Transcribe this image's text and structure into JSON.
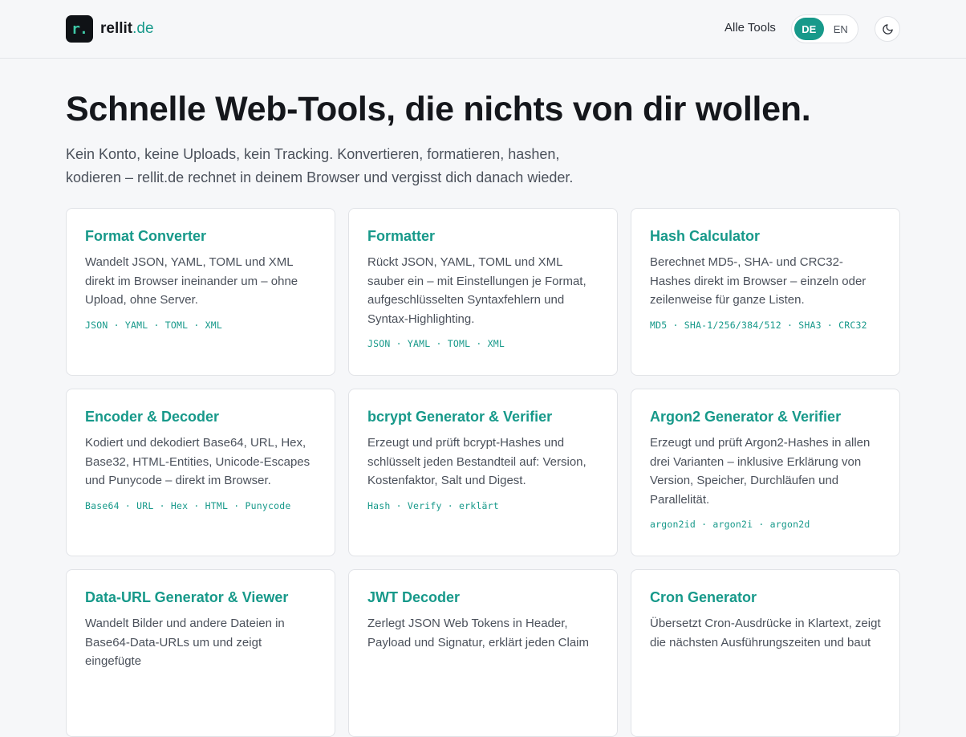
{
  "header": {
    "logo_mark": "r.",
    "logo_name": "rellit",
    "logo_tld": ".de",
    "nav_all_tools": "Alle Tools",
    "lang_de": "DE",
    "lang_en": "EN",
    "active_lang": "DE",
    "theme_icon": "moon-icon"
  },
  "hero": {
    "title": "Schnelle Web-Tools, die nichts von dir wollen.",
    "subtitle": "Kein Konto, keine Uploads, kein Tracking. Konvertieren, formatieren, hashen, kodieren – rellit.de rechnet in deinem Browser und vergisst dich danach wieder."
  },
  "tools": [
    {
      "title": "Format Converter",
      "desc": "Wandelt JSON, YAML, TOML und XML direkt im Browser ineinander um – ohne Upload, ohne Server.",
      "tags": "JSON · YAML · TOML · XML"
    },
    {
      "title": "Formatter",
      "desc": "Rückt JSON, YAML, TOML und XML sauber ein – mit Einstellungen je Format, aufgeschlüsselten Syntaxfehlern und Syntax-Highlighting.",
      "tags": "JSON · YAML · TOML · XML"
    },
    {
      "title": "Hash Calculator",
      "desc": "Berechnet MD5-, SHA- und CRC32-Hashes direkt im Browser – einzeln oder zeilenweise für ganze Listen.",
      "tags": "MD5 · SHA-1/256/384/512 · SHA3 · CRC32"
    },
    {
      "title": "Encoder & Decoder",
      "desc": "Kodiert und dekodiert Base64, URL, Hex, Base32, HTML-Entities, Unicode-Escapes und Punycode – direkt im Browser.",
      "tags": "Base64 · URL · Hex · HTML · Punycode"
    },
    {
      "title": "bcrypt Generator & Verifier",
      "desc": "Erzeugt und prüft bcrypt-Hashes und schlüsselt jeden Bestandteil auf: Version, Kostenfaktor, Salt und Digest.",
      "tags": "Hash · Verify · erklärt"
    },
    {
      "title": "Argon2 Generator & Verifier",
      "desc": "Erzeugt und prüft Argon2-Hashes in allen drei Varianten – inklusive Erklärung von Version, Speicher, Durchläufen und Parallelität.",
      "tags": "argon2id · argon2i · argon2d"
    },
    {
      "title": "Data-URL Generator & Viewer",
      "desc": "Wandelt Bilder und andere Dateien in Base64-Data-URLs um und zeigt eingefügte",
      "tags": ""
    },
    {
      "title": "JWT Decoder",
      "desc": "Zerlegt JSON Web Tokens in Header, Payload und Signatur, erklärt jeden Claim",
      "tags": ""
    },
    {
      "title": "Cron Generator",
      "desc": "Übersetzt Cron-Ausdrücke in Klartext, zeigt die nächsten Ausführungszeiten und baut",
      "tags": ""
    }
  ]
}
